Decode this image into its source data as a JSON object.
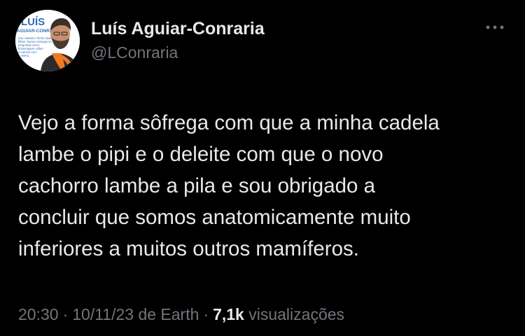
{
  "author": {
    "display_name": "Luís Aguiar-Conraria",
    "handle": "@LConraria",
    "avatar": {
      "lines": [
        "LUÍS",
        "AGUIAR-CONRARIA"
      ],
      "blurb": [
        "Sou casado e tenho duas",
        "filhas. Nunca consegui ter",
        "perguntas como",
        "homenagem colher",
        "a carreira com",
        "a minha."
      ]
    }
  },
  "more_icon": "ellipsis-icon",
  "tweet": {
    "lines": [
      "Vejo a forma sôfrega com que a minha cadela",
      "lambe o pipi e o deleite com que o novo",
      "cachorro lambe a pila e sou obrigado a",
      "concluir que somos anatomicamente muito",
      "inferiores a muitos outros mamíferos."
    ]
  },
  "meta": {
    "time": "20:30",
    "separator": "·",
    "date_source": "10/11/23 de Earth",
    "views_count": "7,1k",
    "views_label": "visualizações"
  },
  "colors": {
    "background": "#000000",
    "primary_text": "#e7e9ea",
    "secondary_text": "#71767b",
    "avatar_accent": "#f07a22",
    "avatar_blue": "#2f6db5"
  }
}
